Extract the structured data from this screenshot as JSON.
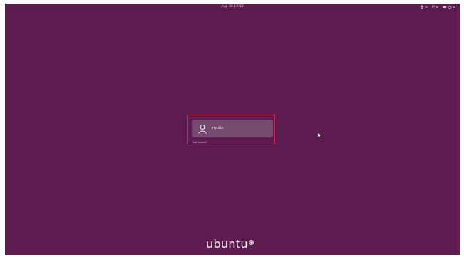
{
  "topbar": {
    "clock": "Aug 30  12:12",
    "language_indicator": "ja"
  },
  "login": {
    "users": [
      {
        "name": "nvidia",
        "icon": "user-icon"
      }
    ],
    "not_listed_label": "Not listed?"
  },
  "branding": {
    "wordmark": "ubuntu",
    "logo_icon": "circle-of-friends-icon"
  },
  "colors": {
    "background": "#5d1b4f",
    "user_tile": "#764a6e",
    "highlight_frame": "#c8234a",
    "text": "#f1e4ed"
  }
}
